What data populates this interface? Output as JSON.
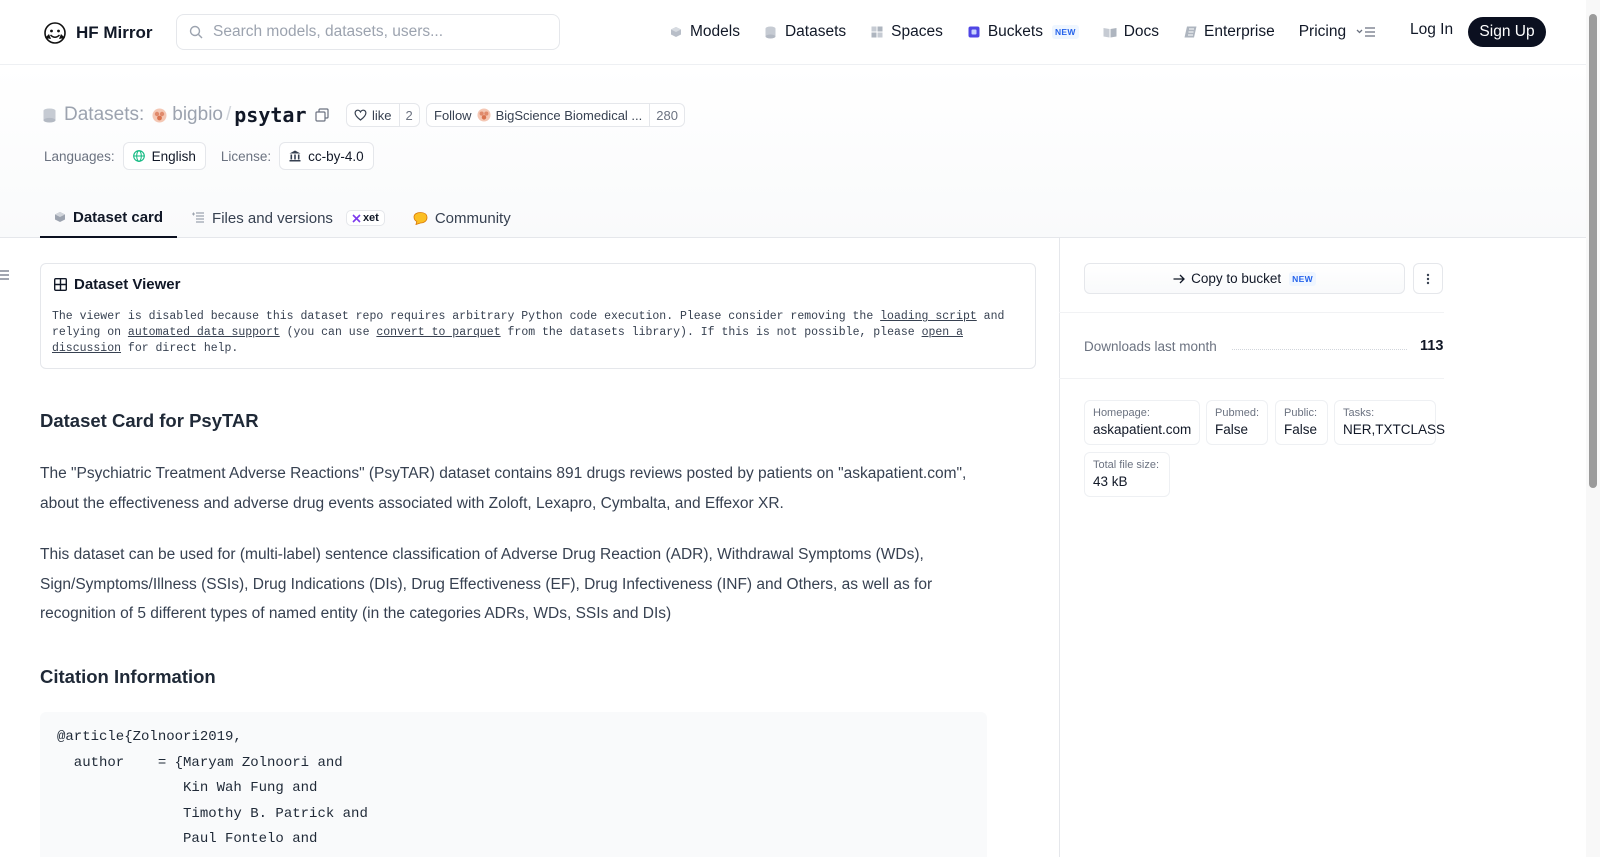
{
  "navbar": {
    "brand": "HF Mirror",
    "search_placeholder": "Search models, datasets, users...",
    "links": [
      {
        "label": "Models",
        "icon": "cube-icon"
      },
      {
        "label": "Datasets",
        "icon": "database-icon"
      },
      {
        "label": "Spaces",
        "icon": "grid-icon"
      },
      {
        "label": "Buckets",
        "icon": "bucket-icon",
        "badge": "NEW"
      },
      {
        "label": "Docs",
        "icon": "book-icon"
      },
      {
        "label": "Enterprise",
        "icon": "enterprise-icon"
      },
      {
        "label": "Pricing"
      }
    ],
    "login": "Log In",
    "signup": "Sign Up"
  },
  "header": {
    "section": "Datasets:",
    "org": "bigbio",
    "separator": "/",
    "repo": "psytar",
    "like_label": "like",
    "like_count": "2",
    "follow_label": "Follow",
    "follow_org": "BigScience Biomedical ...",
    "follow_count": "280",
    "languages_label": "Languages:",
    "language": "English",
    "license_label": "License:",
    "license": "cc-by-4.0"
  },
  "tabs": [
    {
      "label": "Dataset card",
      "active": true
    },
    {
      "label": "Files and versions",
      "badge": "xet"
    },
    {
      "label": "Community"
    }
  ],
  "viewer": {
    "title": "Dataset Viewer",
    "msg_1": "The viewer is disabled because this dataset repo requires arbitrary Python code execution. Please consider removing the ",
    "link_1": "loading script",
    "msg_2": " and relying on ",
    "link_2": "automated data support",
    "msg_3": " (you can use ",
    "link_3": "convert to parquet",
    "msg_4": " from the datasets library). If this is not possible, please ",
    "link_4": "open a discussion",
    "msg_5": " for direct help."
  },
  "card": {
    "title": "Dataset Card for PsyTAR",
    "para1": "The \"Psychiatric Treatment Adverse Reactions\" (PsyTAR) dataset contains 891 drugs reviews posted by patients on \"askapatient.com\", about the effectiveness and adverse drug events associated with Zoloft, Lexapro, Cymbalta, and Effexor XR.",
    "para2": "This dataset can be used for (multi-label) sentence classification of Adverse Drug Reaction (ADR), Withdrawal Symptoms (WDs), Sign/Symptoms/Illness (SSIs), Drug Indications (DIs), Drug Effectiveness (EF), Drug Infectiveness (INF) and Others, as well as for recognition of 5 different types of named entity (in the categories ADRs, WDs, SSIs and DIs)",
    "citation_title": "Citation Information",
    "citation": "@article{Zolnoori2019,\n  author    = {Maryam Zolnoori and\n               Kin Wah Fung and\n               Timothy B. Patrick and\n               Paul Fontelo and"
  },
  "sidebar": {
    "copy_bucket": "Copy to bucket",
    "copy_bucket_badge": "NEW",
    "downloads_label": "Downloads last month",
    "downloads_value": "113",
    "info": [
      {
        "label": "Homepage:",
        "value": "askapatient.com"
      },
      {
        "label": "Pubmed:",
        "value": "False"
      },
      {
        "label": "Public:",
        "value": "False"
      },
      {
        "label": "Tasks:",
        "value": "NER,TXTCLASS"
      },
      {
        "label": "Total file size:",
        "value": "43 kB"
      }
    ]
  }
}
